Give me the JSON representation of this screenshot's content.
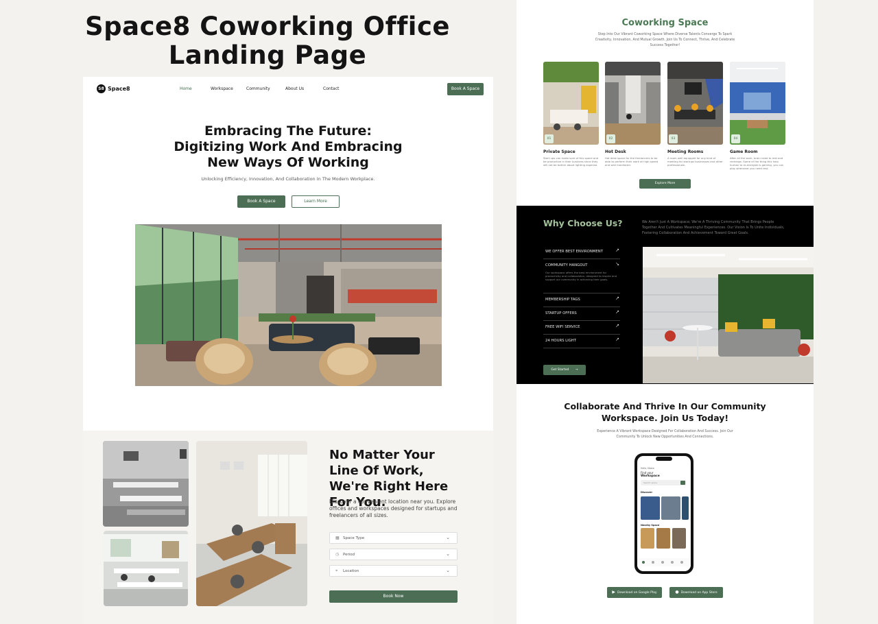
{
  "showcase": {
    "title_line1": "Space8 Coworking  Office",
    "title_line2": "Landing Page"
  },
  "left_page": {
    "nav": {
      "logo_mark": "S8",
      "logo_text": "Space8",
      "links": [
        "Home",
        "Workspace",
        "Community",
        "About Us",
        "Contact"
      ],
      "active_link": "Home",
      "cta": "Book A Space"
    },
    "hero": {
      "title": "Embracing The Future: Digitizing Work And Embracing New Ways Of Working",
      "subtitle": "Unlocking Efficiency, Innovation, And Collaboration In The Modern Workplace.",
      "primary_button": "Book A Space",
      "secondary_button": "Learn More"
    },
    "finder": {
      "title": "No Matter Your Line Of Work, We're Right Here For You.",
      "description": "Discover a convenient location near you. Explore offices and workspaces designed for startups and freelancers of all sizes.",
      "fields": [
        {
          "label": "Space Type",
          "icon": "building-icon"
        },
        {
          "label": "Period",
          "icon": "clock-icon"
        },
        {
          "label": "Location",
          "icon": "pin-icon"
        }
      ],
      "submit": "Book Now"
    }
  },
  "right_page": {
    "coworking": {
      "title": "Coworking Space",
      "description": "Step Into Our Vibrant Coworking Space Where Diverse Talents Converge To Spark Creativity, Innovation, And Mutual Growth. Join Us To Connect, Thrive, And Celebrate Success Together!",
      "cards": [
        {
          "num": "01",
          "title": "Private Space",
          "desc": "Start ups can make sure of this space and be productive in their business since they will not be bother about lighting expense."
        },
        {
          "num": "02",
          "title": "Hot Desk",
          "desc": "Hot desk space for the freelancers to be able to perform their work at high speed and well monitored."
        },
        {
          "num": "03",
          "title": "Meeting Rooms",
          "desc": "A room well equipped for any kind of meeting for startups businesses and other professionals."
        },
        {
          "num": "04",
          "title": "Game Room",
          "desc": "After all the work, brain need to rest and recharge. Some of the thing this help human to re-energize is gaming, you can play whenever you need rest."
        }
      ],
      "button": "Explore More"
    },
    "why": {
      "title": "Why Choose Us?",
      "description": "We Aren't Just A Workspace; We're A Thriving Community That Brings People Together And Cultivates Meaningful Experiences. Our Vision Is To Unite Individuals, Fostering Collaboration And Achievement Toward Great Goals.",
      "items": [
        {
          "label": "WE OFFER BEST ENVIRONMENT",
          "arrow": "↗"
        },
        {
          "label": "COMMUNITY HANGOUT",
          "arrow": "↘",
          "desc": "Our workspace offers the best environment for productivity and collaboration, designed to inspire and support our community in achieving their goals."
        },
        {
          "label": "MEMBERSHIP TAGS",
          "arrow": "↗"
        },
        {
          "label": "STARTUP OFFERS",
          "arrow": "↗"
        },
        {
          "label": "FREE WIFI SERVICE",
          "arrow": "↗"
        },
        {
          "label": "24 HOURS LIGHT",
          "arrow": "↗"
        }
      ],
      "button": "Get Started",
      "button_arrow": "→"
    },
    "collab": {
      "title": "Collaborate And Thrive In Our Community Workspace. Join Us Today!",
      "description": "Experience A Vibrant Workspace Designed For Collaboration And Success. Join Our Community To Unlock New Opportunities And Connections."
    },
    "phone": {
      "greeting": "Hello, Mosta",
      "find": "Find your",
      "workspace": "Workspace",
      "search": "Search space",
      "discover": "Discover",
      "nearby": "Nearby Space"
    },
    "stores": {
      "google": "Download on Google Play",
      "apple": "Download on App Store"
    }
  },
  "colors": {
    "brand_green": "#4b6e55",
    "accent_green": "#a4c29c",
    "dark": "#000000"
  }
}
